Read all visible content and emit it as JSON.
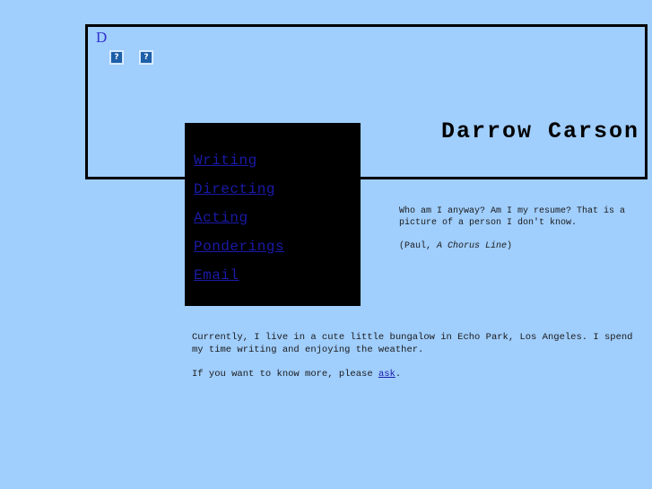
{
  "page": {
    "background_color": "#a0cefd",
    "frame_color": "#000000",
    "nav_panel_color": "#000000",
    "link_color": "#1a1aa8"
  },
  "banner": {
    "initial": "D",
    "icons": [
      {
        "name": "broken-image-placeholder",
        "glyph": "?"
      },
      {
        "name": "broken-image-placeholder",
        "glyph": "?"
      }
    ],
    "title": "Darrow Carson"
  },
  "nav": {
    "items": [
      {
        "label": "Writing"
      },
      {
        "label": "Directing"
      },
      {
        "label": "Acting"
      },
      {
        "label": "Ponderings"
      },
      {
        "label": "Email"
      }
    ]
  },
  "quote": {
    "text": "Who am I anyway? Am I my resume? That is a picture of a person I don't know.",
    "attribution_prefix": "(Paul, ",
    "attribution_work": "A Chorus Line",
    "attribution_suffix": ")"
  },
  "body": {
    "paragraph_1": "Currently, I live in a cute little bungalow in Echo Park, Los Angeles.  I spend my time writing and enjoying the weather.",
    "paragraph_2_before": "If you want to know more, please ",
    "paragraph_2_link": "ask",
    "paragraph_2_after": "."
  }
}
